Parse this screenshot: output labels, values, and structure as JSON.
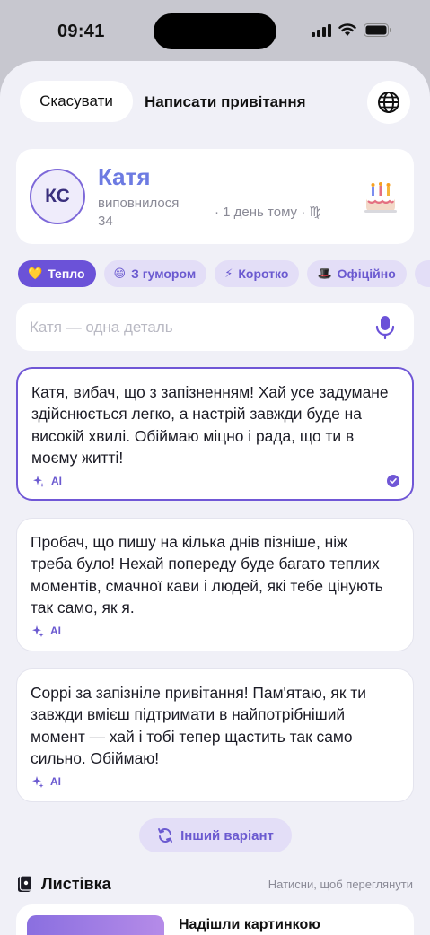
{
  "status_bar": {
    "time": "09:41"
  },
  "header": {
    "cancel_label": "Скасувати",
    "title": "Написати привітання",
    "globe_icon": "globe-icon"
  },
  "profile": {
    "initials": "КС",
    "name": "Катя",
    "turned_label": "виповнилося 34",
    "ago": "· 1 день тому · ♍",
    "cake_icon": "cake-icon"
  },
  "tones": [
    {
      "emoji": "💛",
      "label": "Тепло",
      "active": true
    },
    {
      "emoji": "😄",
      "label": "З гумором",
      "active": false
    },
    {
      "emoji": "⚡",
      "label": "Коротко",
      "active": false
    },
    {
      "emoji": "🎩",
      "label": "Офіційно",
      "active": false
    }
  ],
  "detail_input": {
    "placeholder": "Катя — одна деталь",
    "value": ""
  },
  "suggestions": [
    {
      "text": "Катя, вибач, що з запізненням! Хай усе задумане здійснюється легко, а настрій завжди буде на високій хвилі. Обіймаю міцно і рада, що ти в моєму житті!",
      "tag": "AI",
      "selected": true
    },
    {
      "text": "Пробач, що пишу на кілька днів пізніше, ніж треба було! Нехай попереду буде багато теплих моментів, смачної кави і людей, які тебе цінують так само, як я.",
      "tag": "AI",
      "selected": false
    },
    {
      "text": "Соррі за запізніле привітання! Пам'ятаю, як ти завжди вмієш підтримати в найпотрібніший момент — хай і тобі тепер щастить так само сильно. Обіймаю!",
      "tag": "AI",
      "selected": false
    }
  ],
  "other_variant_label": "Інший варіант",
  "postcard_section": {
    "title": "Листівка",
    "hint": "Натисни, щоб переглянути",
    "card_title": "Надішли картинкою"
  },
  "colors": {
    "accent": "#6b52d8",
    "name": "#6d7be2",
    "background": "#f0f0f7"
  }
}
